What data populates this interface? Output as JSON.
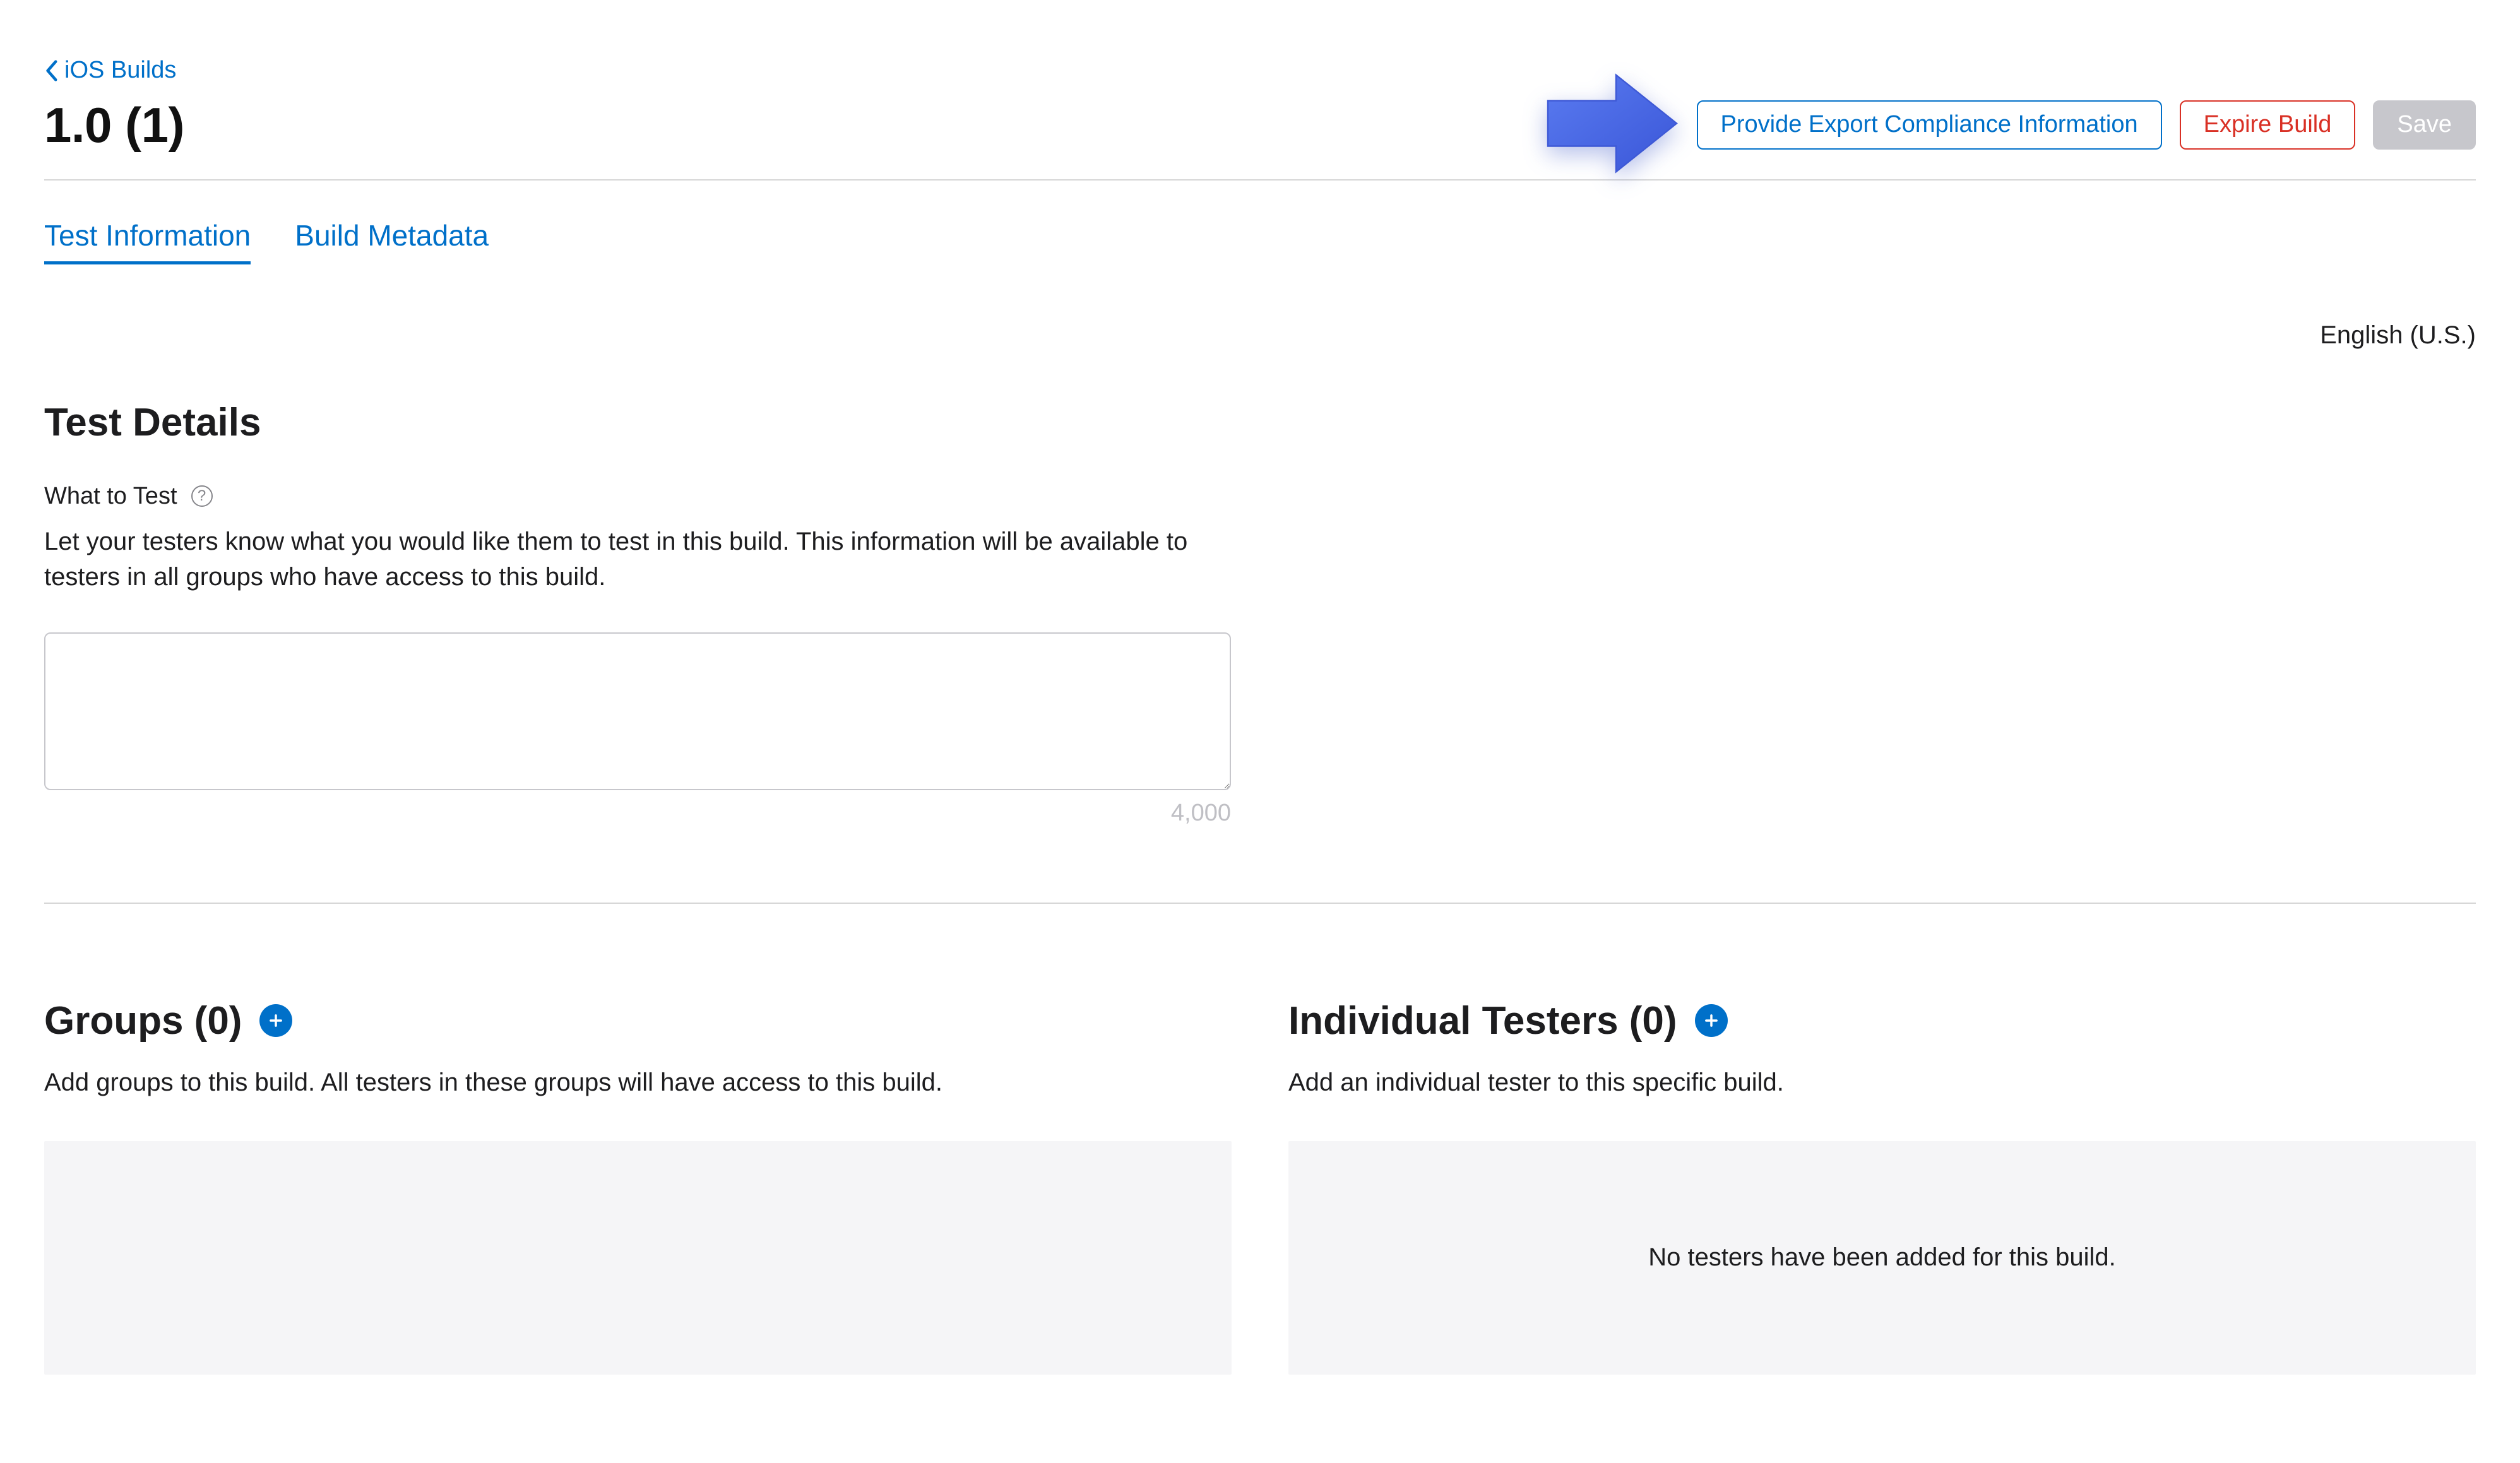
{
  "breadcrumb": {
    "label": "iOS Builds"
  },
  "header": {
    "title": "1.0 (1)",
    "actions": {
      "compliance": "Provide Export Compliance Information",
      "expire": "Expire Build",
      "save": "Save"
    }
  },
  "tabs": [
    {
      "label": "Test Information",
      "active": true
    },
    {
      "label": "Build Metadata",
      "active": false
    }
  ],
  "locale": "English (U.S.)",
  "test_details": {
    "heading": "Test Details",
    "what_to_test_label": "What to Test",
    "what_to_test_desc": "Let your testers know what you would like them to test in this build. This information will be available to testers in all groups who have access to this build.",
    "what_to_test_value": "",
    "char_limit": "4,000"
  },
  "groups": {
    "heading": "Groups (0)",
    "desc": "Add groups to this build. All testers in these groups will have access to this build.",
    "empty": ""
  },
  "testers": {
    "heading": "Individual Testers (0)",
    "desc": "Add an individual tester to this specific build.",
    "empty": "No testers have been added for this build."
  }
}
